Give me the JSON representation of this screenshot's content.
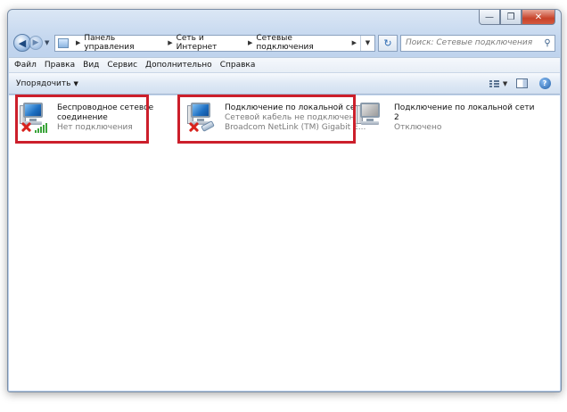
{
  "window": {
    "controls": [
      "—",
      "❐",
      "✕"
    ]
  },
  "nav": {
    "back_glyph": "◀",
    "forward_glyph": "▶",
    "dropdown_glyph": "▼",
    "breadcrumbs": [
      "Панель управления",
      "Сеть и Интернет",
      "Сетевые подключения"
    ],
    "crumb_sep": "▶",
    "refresh_glyph": "↻",
    "search_placeholder": "Поиск: Сетевые подключения"
  },
  "menu": [
    "Файл",
    "Правка",
    "Вид",
    "Сервис",
    "Дополнительно",
    "Справка"
  ],
  "toolbar": {
    "organize_label": "Упорядочить",
    "organize_caret": "▼",
    "views_caret": "▼",
    "help_glyph": "?"
  },
  "connections": [
    {
      "name_line1": "Беспроводное сетевое",
      "name_line2": "соединение",
      "status": "Нет подключения",
      "device": "",
      "icon": "wireless-network-icon",
      "highlighted": true
    },
    {
      "name_line1": "Подключение по локальной сети",
      "name_line2": "",
      "status": "Сетевой кабель не подключен",
      "device": "Broadcom NetLink (TM) Gigabit E...",
      "icon": "wired-network-icon",
      "highlighted": true
    },
    {
      "name_line1": "Подключение по локальной сети",
      "name_line2": "2",
      "status": "Отключено",
      "device": "",
      "icon": "disabled-network-icon",
      "highlighted": false
    }
  ],
  "colors": {
    "highlight": "#cc1f2b",
    "error_x": "#d8231d",
    "signal": "#3aa43a"
  }
}
